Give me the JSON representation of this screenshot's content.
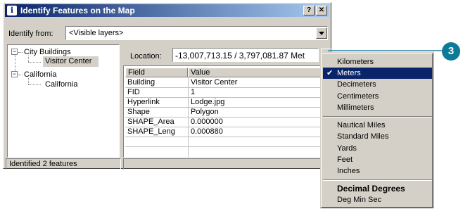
{
  "window": {
    "title": "Identify Features on the Map",
    "icon_glyph": "i",
    "help_glyph": "?",
    "close_glyph": "✕"
  },
  "identify_from": {
    "label": "Identify from:",
    "value": "<Visible layers>"
  },
  "tree": {
    "layers": [
      {
        "name": "City Buildings",
        "features": [
          "Visitor Center"
        ]
      },
      {
        "name": "California",
        "features": [
          "California"
        ]
      }
    ],
    "selected_feature": "Visitor Center"
  },
  "location": {
    "label": "Location:",
    "value": "-13,007,713.15 / 3,797,081.87 Met"
  },
  "grid": {
    "columns": [
      "Field",
      "Value"
    ],
    "rows": [
      [
        "Building",
        "Visitor Center"
      ],
      [
        "FID",
        "1"
      ],
      [
        "Hyperlink",
        "Lodge.jpg"
      ],
      [
        "Shape",
        "Polygon"
      ],
      [
        "SHAPE_Area",
        "0.000000"
      ],
      [
        "SHAPE_Leng",
        "0.000880"
      ]
    ]
  },
  "status": {
    "text": "Identified 2 features"
  },
  "units_menu": {
    "group1": [
      "Kilometers",
      "Meters",
      "Decimeters",
      "Centimeters",
      "Millimeters"
    ],
    "group2": [
      "Nautical Miles",
      "Standard Miles",
      "Yards",
      "Feet",
      "Inches"
    ],
    "group3": [
      "Decimal Degrees",
      "Deg Min Sec"
    ],
    "selected": "Meters",
    "check_glyph": "✔"
  },
  "callout": {
    "number": "3"
  },
  "colors": {
    "title_bar": "#0a246a",
    "menu_highlight": "#0a246a",
    "dialog_face": "#d4d0c8",
    "callout": "#0d7a9a"
  }
}
